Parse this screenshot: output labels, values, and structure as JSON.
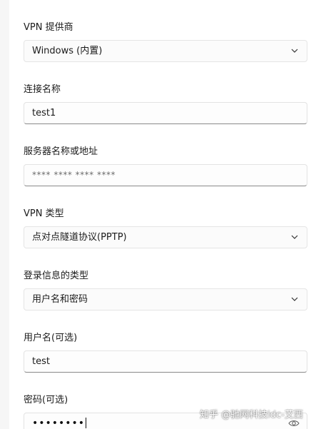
{
  "vpn_provider": {
    "label": "VPN 提供商",
    "value": "Windows (内置)"
  },
  "connection_name": {
    "label": "连接名称",
    "value": "test1"
  },
  "server_address": {
    "label": "服务器名称或地址",
    "value": "**** **** **** ****"
  },
  "vpn_type": {
    "label": "VPN 类型",
    "value": "点对点隧道协议(PPTP)"
  },
  "sign_in_type": {
    "label": "登录信息的类型",
    "value": "用户名和密码"
  },
  "username": {
    "label": "用户名(可选)",
    "value": "test"
  },
  "password": {
    "label": "密码(可选)",
    "value": "••••••••"
  },
  "watermark": "知乎 @驰网科技idc-艾西",
  "icons": {
    "dropdown": "chevron-down-icon",
    "reveal_password": "eye-icon"
  }
}
